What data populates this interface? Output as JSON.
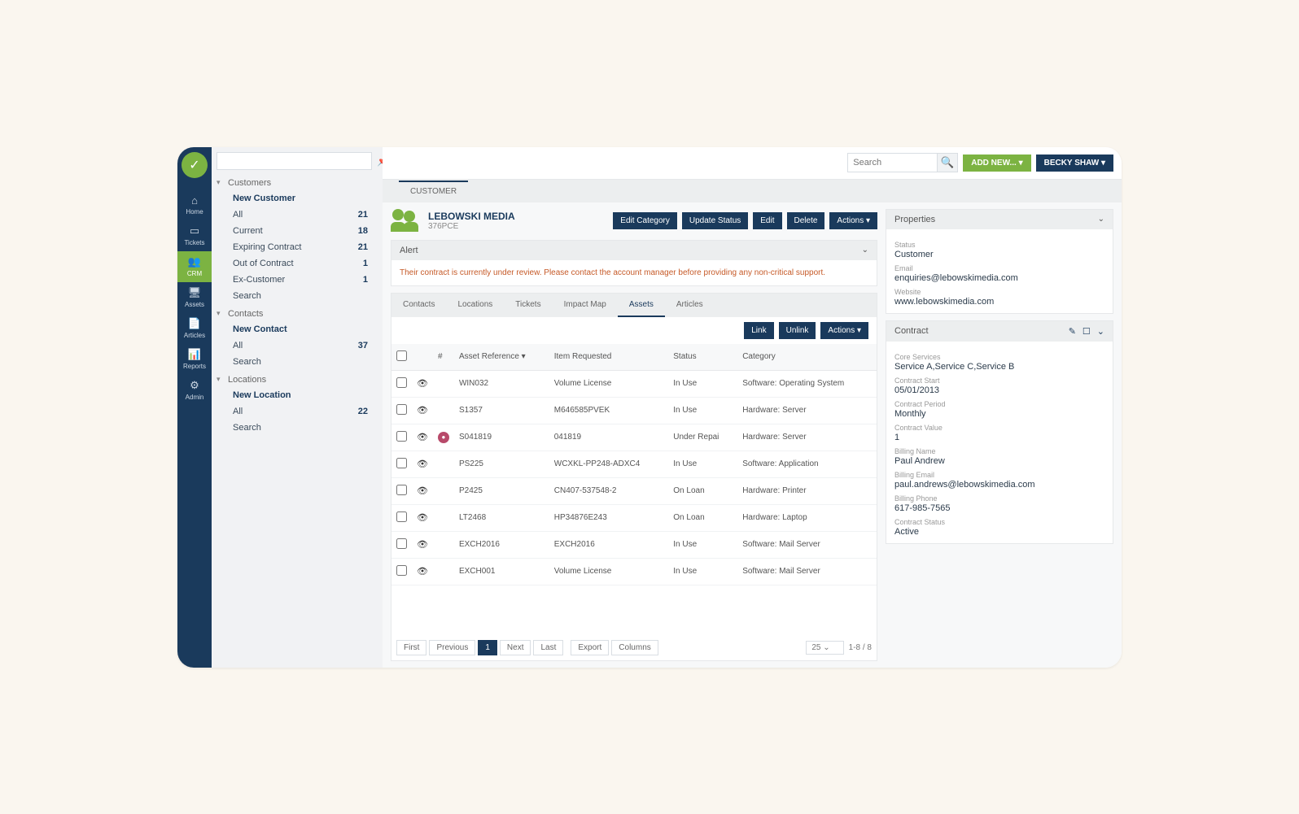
{
  "topbar": {
    "search_placeholder": "Search",
    "add_new": "ADD NEW... ▾",
    "user": "BECKY SHAW ▾"
  },
  "rail": [
    {
      "label": "Home",
      "icon": "⌂"
    },
    {
      "label": "Tickets",
      "icon": "▭"
    },
    {
      "label": "CRM",
      "icon": "👥"
    },
    {
      "label": "Assets",
      "icon": "🖥"
    },
    {
      "label": "Articles",
      "icon": "📄"
    },
    {
      "label": "Reports",
      "icon": "📊"
    },
    {
      "label": "Admin",
      "icon": "⚙"
    }
  ],
  "sidebar": {
    "sections": [
      {
        "title": "Customers",
        "items": [
          {
            "label": "New Customer",
            "bold": true
          },
          {
            "label": "All",
            "count": "21"
          },
          {
            "label": "Current",
            "count": "18"
          },
          {
            "label": "Expiring Contract",
            "count": "21"
          },
          {
            "label": "Out of Contract",
            "count": "1"
          },
          {
            "label": "Ex-Customer",
            "count": "1"
          },
          {
            "label": "Search"
          }
        ]
      },
      {
        "title": "Contacts",
        "items": [
          {
            "label": "New Contact",
            "bold": true
          },
          {
            "label": "All",
            "count": "37"
          },
          {
            "label": "Search"
          }
        ]
      },
      {
        "title": "Locations",
        "items": [
          {
            "label": "New Location",
            "bold": true
          },
          {
            "label": "All",
            "count": "22"
          },
          {
            "label": "Search"
          }
        ]
      }
    ]
  },
  "page_tab": "CUSTOMER",
  "customer": {
    "name": "LEBOWSKI MEDIA",
    "code": "376PCE"
  },
  "header_buttons": {
    "edit_category": "Edit Category",
    "update_status": "Update Status",
    "edit": "Edit",
    "delete": "Delete",
    "actions": "Actions ▾"
  },
  "alert": {
    "title": "Alert",
    "message": "Their contract is currently under review. Please contact the account manager before providing any non-critical support."
  },
  "subtabs": [
    "Contacts",
    "Locations",
    "Tickets",
    "Impact Map",
    "Assets",
    "Articles"
  ],
  "subtab_active": "Assets",
  "asset_actions": {
    "link": "Link",
    "unlink": "Unlink",
    "actions": "Actions ▾"
  },
  "table": {
    "columns": {
      "hash": "#",
      "ref": "Asset Reference ▾",
      "item": "Item Requested",
      "status": "Status",
      "category": "Category"
    },
    "rows": [
      {
        "ref": "WIN032",
        "item": "Volume License",
        "status": "In Use",
        "category": "Software: Operating System"
      },
      {
        "ref": "S1357",
        "item": "M646585PVEK",
        "status": "In Use",
        "category": "Hardware: Server"
      },
      {
        "ref": "S041819",
        "item": "041819",
        "status": "Under Repai",
        "category": "Hardware: Server",
        "badge": true
      },
      {
        "ref": "PS225",
        "item": "WCXKL-PP248-ADXC4",
        "status": "In Use",
        "category": "Software: Application"
      },
      {
        "ref": "P2425",
        "item": "CN407-537548-2",
        "status": "On Loan",
        "category": "Hardware: Printer"
      },
      {
        "ref": "LT2468",
        "item": "HP34876E243",
        "status": "On Loan",
        "category": "Hardware: Laptop"
      },
      {
        "ref": "EXCH2016",
        "item": "EXCH2016",
        "status": "In Use",
        "category": "Software: Mail Server"
      },
      {
        "ref": "EXCH001",
        "item": "Volume License",
        "status": "In Use",
        "category": "Software: Mail Server"
      }
    ]
  },
  "pager": {
    "first": "First",
    "prev": "Previous",
    "page": "1",
    "next": "Next",
    "last": "Last",
    "export": "Export",
    "columns": "Columns",
    "per_page": "25",
    "range": "1-8 / 8"
  },
  "properties": {
    "title": "Properties",
    "status_lbl": "Status",
    "status_val": "Customer",
    "email_lbl": "Email",
    "email_val": "enquiries@lebowskimedia.com",
    "website_lbl": "Website",
    "website_val": "www.lebowskimedia.com"
  },
  "contract": {
    "title": "Contract",
    "core_lbl": "Core Services",
    "core_val": "Service A,Service C,Service B",
    "start_lbl": "Contract Start",
    "start_val": "05/01/2013",
    "period_lbl": "Contract Period",
    "period_val": "Monthly",
    "value_lbl": "Contract Value",
    "value_val": "1",
    "bname_lbl": "Billing Name",
    "bname_val": "Paul Andrew",
    "bemail_lbl": "Billing Email",
    "bemail_val": "paul.andrews@lebowskimedia.com",
    "bphone_lbl": "Billing Phone",
    "bphone_val": "617-985-7565",
    "cstatus_lbl": "Contract Status",
    "cstatus_val": "Active"
  }
}
